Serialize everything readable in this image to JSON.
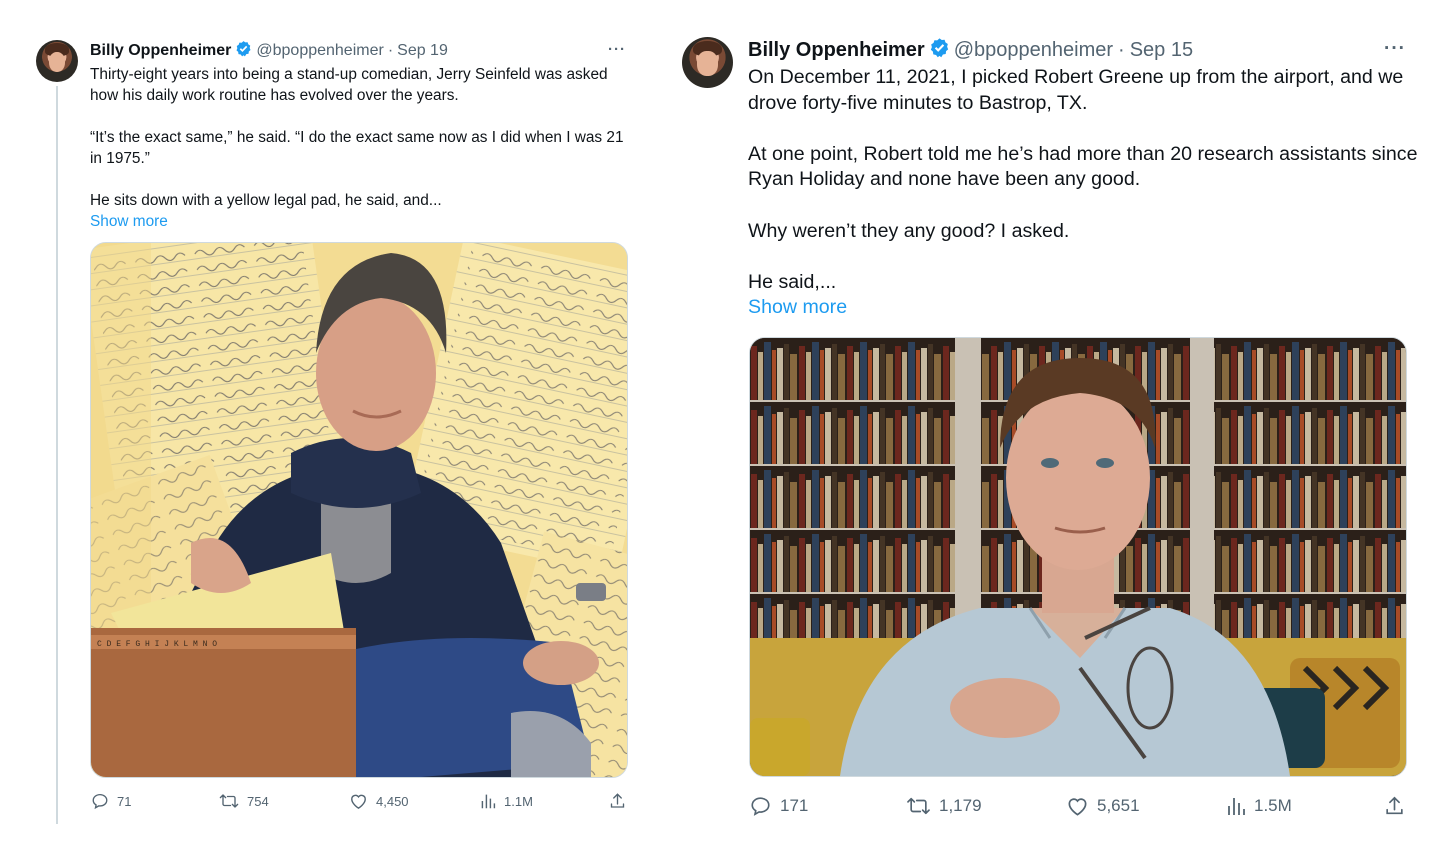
{
  "tweet1": {
    "name": "Billy Oppenheimer",
    "handle": "@bpoppenheimer",
    "sep": "·",
    "date": "Sep 19",
    "more": "···",
    "paragraphs": [
      "Thirty-eight years into being a stand-up comedian, Jerry Seinfeld was asked how his daily work routine has evolved over the years.",
      "“It’s the exact same,” he said. “I do the exact same now as I did when I was 21 in 1975.”",
      "He sits down with a yellow legal pad, he said, and..."
    ],
    "show_more": "Show more",
    "replies": "71",
    "retweets": "754",
    "likes": "4,450",
    "views": "1.1M",
    "index_tabs": "C D E F G H I J K L M N O"
  },
  "tweet2": {
    "name": "Billy Oppenheimer",
    "handle": "@bpoppenheimer",
    "sep": "·",
    "date": "Sep 15",
    "more": "···",
    "paragraphs": [
      "On December 11, 2021, I picked Robert Greene up from the airport, and we drove forty-five minutes to Bastrop, TX.",
      "At one point, Robert told me he’s had more than 20 research assistants since Ryan Holiday and none have been any good.",
      "Why weren’t they any good? I asked.",
      "He said,..."
    ],
    "show_more": "Show more",
    "replies": "171",
    "retweets": "1,179",
    "likes": "5,651",
    "views": "1.5M"
  },
  "colors": {
    "link": "#1d9bf0",
    "muted": "#536471",
    "text": "#0f1419",
    "verified": "#1d9bf0"
  }
}
